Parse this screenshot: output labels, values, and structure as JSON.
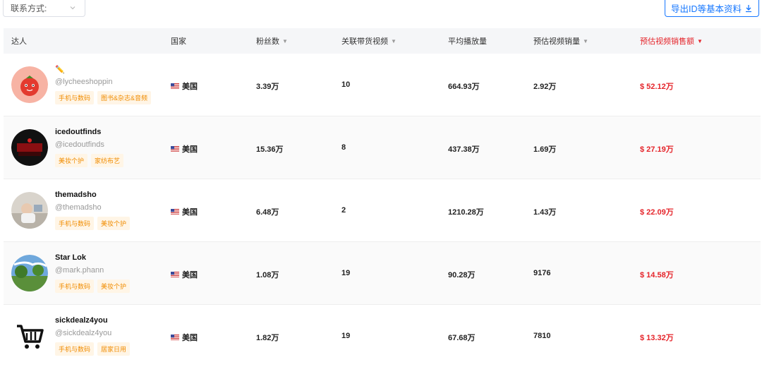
{
  "filter": {
    "label": "联系方式:"
  },
  "export": {
    "label": "导出ID等基本资料"
  },
  "columns": {
    "creator": "达人",
    "country": "国家",
    "followers": "粉丝数",
    "videos": "关联带货视频",
    "avg_views": "平均播放量",
    "video_sales": "预估视频销量",
    "sales_amount": "预估视频销售额"
  },
  "rows": [
    {
      "name": "✏️",
      "handle": "@lycheeshoppin",
      "tags": [
        "手机与数码",
        "图书&杂志&音频"
      ],
      "country": "美国",
      "followers": "3.39万",
      "videos": "10",
      "avg_views": "664.93万",
      "video_sales": "2.92万",
      "sales_amount": "$ 52.12万",
      "avatar": "lychee"
    },
    {
      "name": "icedoutfinds",
      "handle": "@icedoutfinds",
      "tags": [
        "美妆个护",
        "家纺布艺"
      ],
      "country": "美国",
      "followers": "15.36万",
      "videos": "8",
      "avg_views": "437.38万",
      "video_sales": "1.69万",
      "sales_amount": "$ 27.19万",
      "avatar": "dark-red"
    },
    {
      "name": "themadsho",
      "handle": "@themadsho",
      "tags": [
        "手机与数码",
        "美妆个护"
      ],
      "country": "美国",
      "followers": "6.48万",
      "videos": "2",
      "avg_views": "1210.28万",
      "video_sales": "1.43万",
      "sales_amount": "$ 22.09万",
      "avatar": "photo"
    },
    {
      "name": "Star Lok",
      "handle": "@mark.phann",
      "tags": [
        "手机与数码",
        "美妆个护"
      ],
      "country": "美国",
      "followers": "1.08万",
      "videos": "19",
      "avg_views": "90.28万",
      "video_sales": "9176",
      "sales_amount": "$ 14.58万",
      "avatar": "landscape"
    },
    {
      "name": "sickdealz4you",
      "handle": "@sickdealz4you",
      "tags": [
        "手机与数码",
        "居家日用"
      ],
      "country": "美国",
      "followers": "1.82万",
      "videos": "19",
      "avg_views": "67.68万",
      "video_sales": "7810",
      "sales_amount": "$ 13.32万",
      "avatar": "cart"
    }
  ],
  "colors": {
    "accent": "#1677ff",
    "sales_red": "#e5242a",
    "tag_orange": "#f08c00"
  }
}
